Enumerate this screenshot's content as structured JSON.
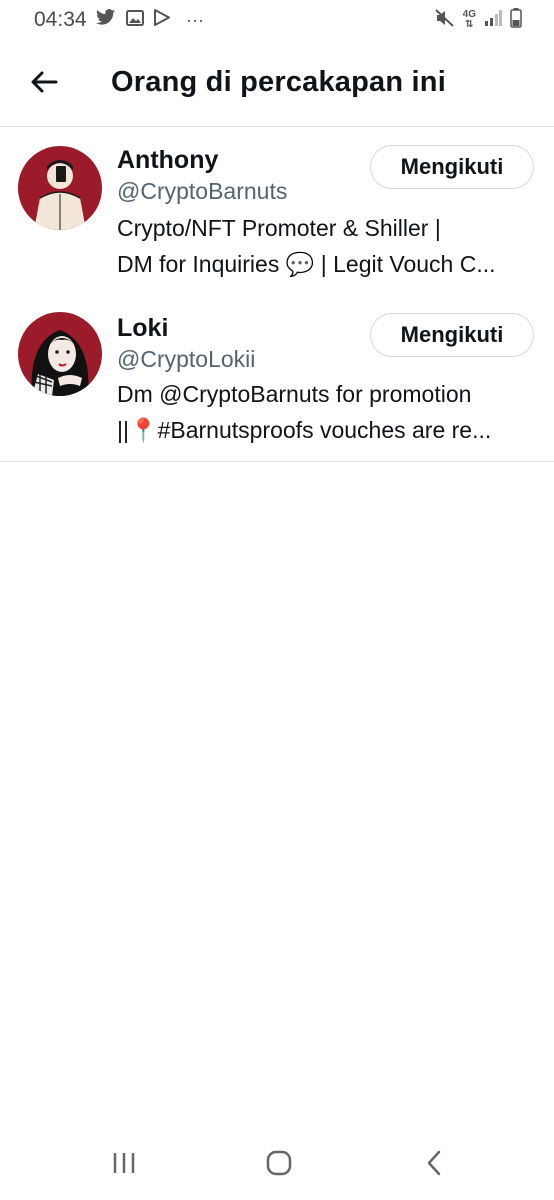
{
  "status_bar": {
    "time": "04:34",
    "more_dots": "···",
    "network": "4G"
  },
  "header": {
    "title": "Orang di percakapan ini"
  },
  "users": [
    {
      "name": "Anthony",
      "handle": "@CryptoBarnuts",
      "bio_line1": "Crypto/NFT Promoter & Shiller |",
      "bio_line2": "DM for Inquiries 💬 | Legit Vouch C...",
      "follow_label": "Mengikuti"
    },
    {
      "name": "Loki",
      "handle": "@CryptoLokii",
      "bio_line1": "Dm @CryptoBarnuts for promotion",
      "bio_line2": "||📍#Barnutsproofs vouches are re...",
      "follow_label": "Mengikuti"
    }
  ],
  "colors": {
    "accent_text": "#0f1419",
    "secondary_text": "#536471",
    "divider": "#dfe3e6",
    "avatar_bg": "#9b1b2a"
  }
}
